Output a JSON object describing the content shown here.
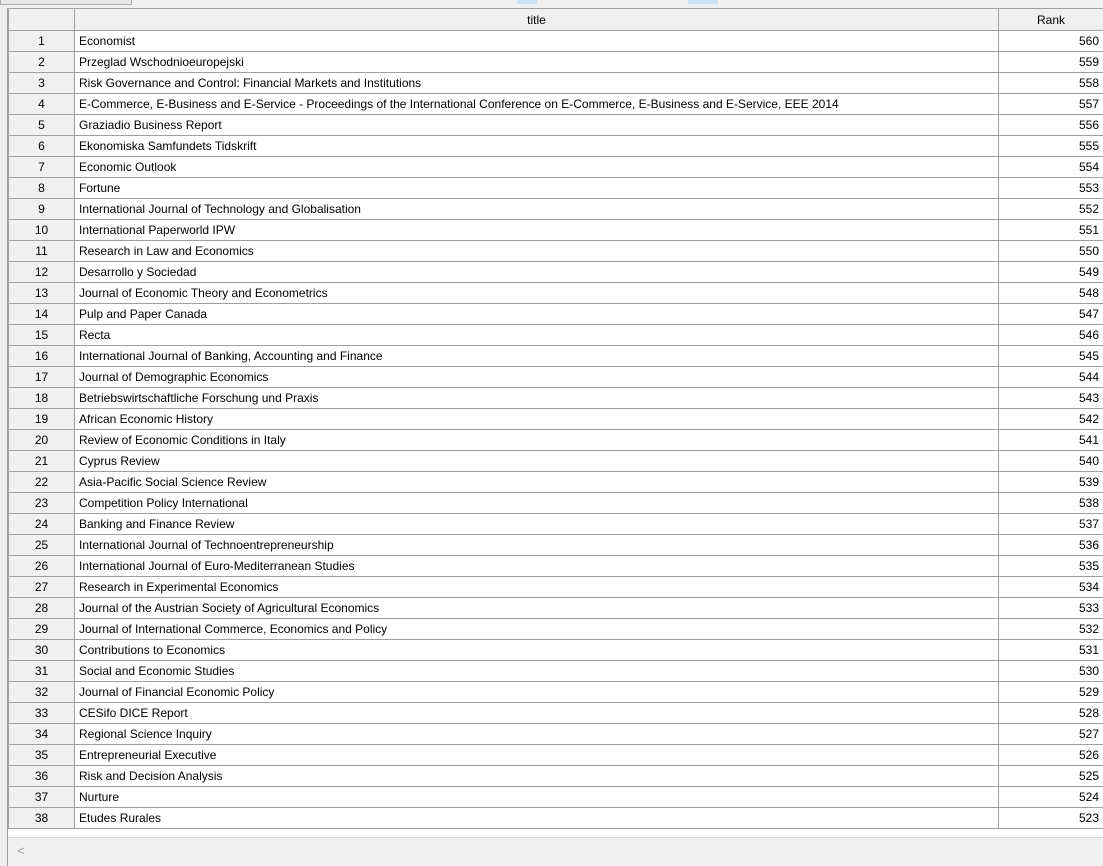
{
  "grid": {
    "columns": {
      "title": "title",
      "rank": "Rank"
    },
    "rows": [
      {
        "n": "1",
        "title": "Economist",
        "rank": "560"
      },
      {
        "n": "2",
        "title": "Przeglad Wschodnioeuropejski",
        "rank": "559"
      },
      {
        "n": "3",
        "title": "Risk Governance and Control: Financial Markets and Institutions",
        "rank": "558"
      },
      {
        "n": "4",
        "title": "E-Commerce, E-Business and E-Service - Proceedings of the International Conference on E-Commerce, E-Business and E-Service, EEE 2014",
        "rank": "557"
      },
      {
        "n": "5",
        "title": "Graziadio Business Report",
        "rank": "556"
      },
      {
        "n": "6",
        "title": "Ekonomiska Samfundets Tidskrift",
        "rank": "555"
      },
      {
        "n": "7",
        "title": "Economic Outlook",
        "rank": "554"
      },
      {
        "n": "8",
        "title": "Fortune",
        "rank": "553"
      },
      {
        "n": "9",
        "title": "International Journal of Technology and Globalisation",
        "rank": "552"
      },
      {
        "n": "10",
        "title": "International Paperworld IPW",
        "rank": "551"
      },
      {
        "n": "11",
        "title": "Research in Law and Economics",
        "rank": "550"
      },
      {
        "n": "12",
        "title": "Desarrollo y Sociedad",
        "rank": "549"
      },
      {
        "n": "13",
        "title": "Journal of Economic Theory and Econometrics",
        "rank": "548"
      },
      {
        "n": "14",
        "title": "Pulp and Paper Canada",
        "rank": "547"
      },
      {
        "n": "15",
        "title": "Recta",
        "rank": "546"
      },
      {
        "n": "16",
        "title": "International Journal of Banking, Accounting and Finance",
        "rank": "545"
      },
      {
        "n": "17",
        "title": "Journal of Demographic Economics",
        "rank": "544"
      },
      {
        "n": "18",
        "title": "Betriebswirtschaftliche Forschung und Praxis",
        "rank": "543"
      },
      {
        "n": "19",
        "title": "African Economic History",
        "rank": "542"
      },
      {
        "n": "20",
        "title": "Review of Economic Conditions in Italy",
        "rank": "541"
      },
      {
        "n": "21",
        "title": "Cyprus Review",
        "rank": "540"
      },
      {
        "n": "22",
        "title": "Asia-Pacific Social Science Review",
        "rank": "539"
      },
      {
        "n": "23",
        "title": "Competition Policy International",
        "rank": "538"
      },
      {
        "n": "24",
        "title": "Banking and Finance Review",
        "rank": "537"
      },
      {
        "n": "25",
        "title": "International Journal of Technoentrepreneurship",
        "rank": "536"
      },
      {
        "n": "26",
        "title": "International Journal of Euro-Mediterranean Studies",
        "rank": "535"
      },
      {
        "n": "27",
        "title": "Research in Experimental Economics",
        "rank": "534"
      },
      {
        "n": "28",
        "title": "Journal of the Austrian Society of Agricultural Economics",
        "rank": "533"
      },
      {
        "n": "29",
        "title": "Journal of International Commerce, Economics and Policy",
        "rank": "532"
      },
      {
        "n": "30",
        "title": "Contributions to Economics",
        "rank": "531"
      },
      {
        "n": "31",
        "title": "Social and Economic Studies",
        "rank": "530"
      },
      {
        "n": "32",
        "title": "Journal of Financial Economic Policy",
        "rank": "529"
      },
      {
        "n": "33",
        "title": "CESifo DICE Report",
        "rank": "528"
      },
      {
        "n": "34",
        "title": "Regional Science Inquiry",
        "rank": "527"
      },
      {
        "n": "35",
        "title": "Entrepreneurial Executive",
        "rank": "526"
      },
      {
        "n": "36",
        "title": "Risk and Decision Analysis",
        "rank": "525"
      },
      {
        "n": "37",
        "title": "Nurture",
        "rank": "524"
      },
      {
        "n": "38",
        "title": "Etudes Rurales",
        "rank": "523"
      }
    ]
  },
  "scrollbar": {
    "left_arrow": "<"
  },
  "icons": {
    "scroll_left": "chevron-left-icon"
  },
  "colors": {
    "header_bg": "#f0f0f0",
    "grid_line": "#a0a0a0",
    "highlight": "#cce4f7"
  }
}
